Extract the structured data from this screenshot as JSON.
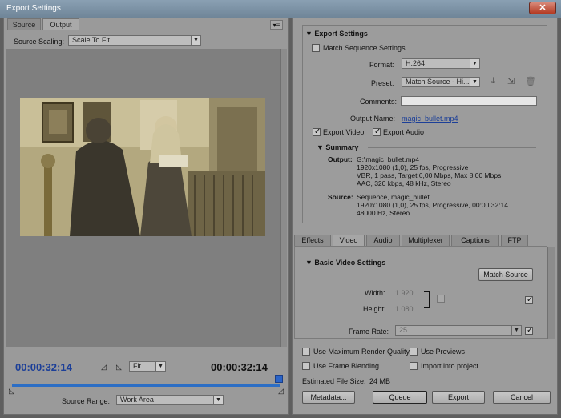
{
  "window": {
    "title": "Export Settings"
  },
  "left": {
    "tabs": [
      "Source",
      "Output"
    ],
    "source_scaling_label": "Source Scaling:",
    "source_scaling_value": "Scale To Fit",
    "timecode_current": "00:00:32:14",
    "timecode_duration": "00:00:32:14",
    "zoom_value": "Fit",
    "source_range_label": "Source Range:",
    "source_range_value": "Work Area"
  },
  "export_settings": {
    "header": "Export Settings",
    "match_sequence_label": "Match Sequence Settings",
    "format_label": "Format:",
    "format_value": "H.264",
    "preset_label": "Preset:",
    "preset_value": "Match Source - Hi...",
    "comments_label": "Comments:",
    "comments_value": "",
    "output_name_label": "Output Name:",
    "output_name_value": "magic_bullet.mp4",
    "export_video_label": "Export Video",
    "export_audio_label": "Export Audio"
  },
  "summary": {
    "header": "Summary",
    "output_label": "Output:",
    "output_lines": [
      "G:\\magic_bullet.mp4",
      "1920x1080 (1,0), 25 fps, Progressive",
      "VBR, 1 pass, Target 6,00 Mbps, Max 8,00 Mbps",
      "AAC, 320 kbps, 48 kHz, Stereo"
    ],
    "source_label": "Source:",
    "source_lines": [
      "Sequence, magic_bullet",
      "1920x1080 (1,0), 25 fps, Progressive, 00:00:32:14",
      "48000 Hz, Stereo"
    ]
  },
  "settings_tabs": [
    "Effects",
    "Video",
    "Audio",
    "Multiplexer",
    "Captions",
    "FTP"
  ],
  "video": {
    "header": "Basic Video Settings",
    "match_source_button": "Match Source",
    "width_label": "Width:",
    "width_value": "1 920",
    "height_label": "Height:",
    "height_value": "1 080",
    "frame_rate_label": "Frame Rate:",
    "frame_rate_value": "25"
  },
  "bottom": {
    "max_render_quality": "Use Maximum Render Quality",
    "use_previews": "Use Previews",
    "frame_blending": "Use Frame Blending",
    "import_into_project": "Import into project",
    "estimated_size_label": "Estimated File Size:",
    "estimated_size_value": "24 MB",
    "buttons": {
      "metadata": "Metadata...",
      "queue": "Queue",
      "export": "Export",
      "cancel": "Cancel"
    }
  }
}
